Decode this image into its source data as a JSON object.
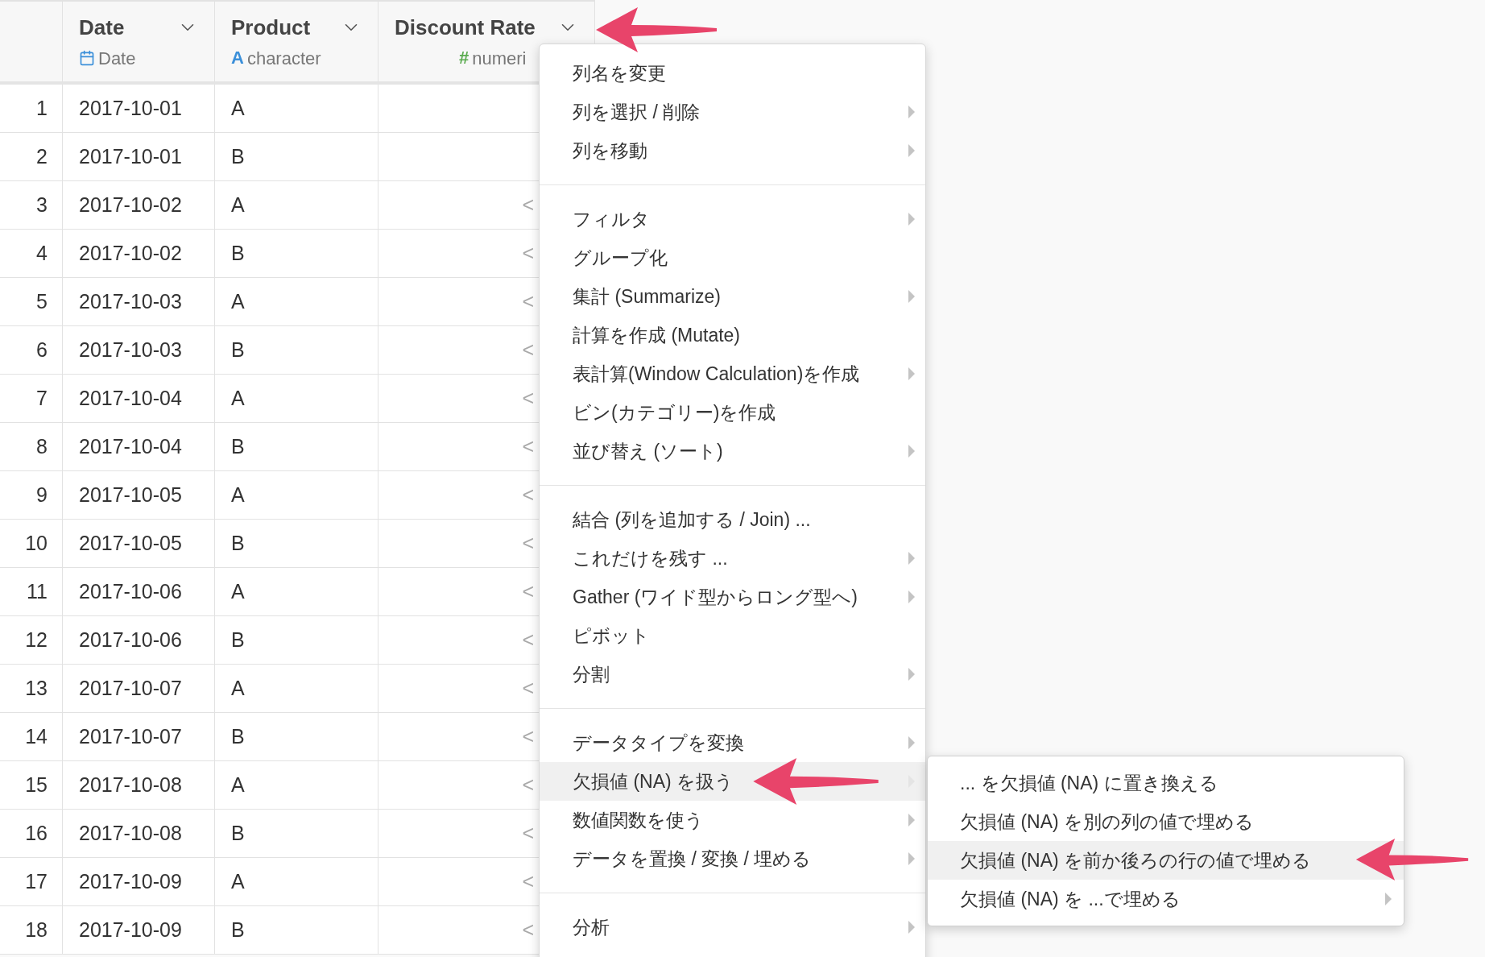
{
  "table": {
    "columns": [
      {
        "name": "Date",
        "type": "Date",
        "kind": "date"
      },
      {
        "name": "Product",
        "type": "character",
        "kind": "character",
        "type_glyph": "A"
      },
      {
        "name": "Discount Rate",
        "type": "numeri",
        "kind": "numeric",
        "type_glyph": "#"
      }
    ],
    "rows": [
      {
        "num": "1",
        "date": "2017-10-01",
        "product": "A"
      },
      {
        "num": "2",
        "date": "2017-10-01",
        "product": "B"
      },
      {
        "num": "3",
        "date": "2017-10-02",
        "product": "A",
        "discount": "<"
      },
      {
        "num": "4",
        "date": "2017-10-02",
        "product": "B",
        "discount": "<"
      },
      {
        "num": "5",
        "date": "2017-10-03",
        "product": "A",
        "discount": "<"
      },
      {
        "num": "6",
        "date": "2017-10-03",
        "product": "B",
        "discount": "<"
      },
      {
        "num": "7",
        "date": "2017-10-04",
        "product": "A",
        "discount": "<"
      },
      {
        "num": "8",
        "date": "2017-10-04",
        "product": "B",
        "discount": "<"
      },
      {
        "num": "9",
        "date": "2017-10-05",
        "product": "A",
        "discount": "<"
      },
      {
        "num": "10",
        "date": "2017-10-05",
        "product": "B",
        "discount": "<"
      },
      {
        "num": "11",
        "date": "2017-10-06",
        "product": "A",
        "discount": "<"
      },
      {
        "num": "12",
        "date": "2017-10-06",
        "product": "B",
        "discount": "<"
      },
      {
        "num": "13",
        "date": "2017-10-07",
        "product": "A",
        "discount": "<"
      },
      {
        "num": "14",
        "date": "2017-10-07",
        "product": "B",
        "discount": "<"
      },
      {
        "num": "15",
        "date": "2017-10-08",
        "product": "A",
        "discount": "<"
      },
      {
        "num": "16",
        "date": "2017-10-08",
        "product": "B",
        "discount": "<"
      },
      {
        "num": "17",
        "date": "2017-10-09",
        "product": "A",
        "discount": "<"
      },
      {
        "num": "18",
        "date": "2017-10-09",
        "product": "B",
        "discount": "<"
      }
    ]
  },
  "context_menu": {
    "sections": [
      [
        {
          "label": "列名を変更",
          "has_submenu": false,
          "selected": false
        },
        {
          "label": "列を選択 / 削除",
          "has_submenu": true,
          "selected": false
        },
        {
          "label": "列を移動",
          "has_submenu": true,
          "selected": false
        }
      ],
      [
        {
          "label": "フィルタ",
          "has_submenu": true,
          "selected": false
        },
        {
          "label": "グループ化",
          "has_submenu": false,
          "selected": false
        },
        {
          "label": "集計 (Summarize)",
          "has_submenu": true,
          "selected": false
        },
        {
          "label": "計算を作成 (Mutate)",
          "has_submenu": false,
          "selected": false
        },
        {
          "label": "表計算(Window Calculation)を作成",
          "has_submenu": true,
          "selected": false
        },
        {
          "label": "ビン(カテゴリー)を作成",
          "has_submenu": false,
          "selected": false
        },
        {
          "label": "並び替え (ソート)",
          "has_submenu": true,
          "selected": false
        }
      ],
      [
        {
          "label": "結合 (列を追加する / Join) ...",
          "has_submenu": false,
          "selected": false
        },
        {
          "label": "これだけを残す ...",
          "has_submenu": true,
          "selected": false
        },
        {
          "label": "Gather (ワイド型からロング型へ)",
          "has_submenu": true,
          "selected": false
        },
        {
          "label": "ピボット",
          "has_submenu": false,
          "selected": false
        },
        {
          "label": "分割",
          "has_submenu": true,
          "selected": false
        }
      ],
      [
        {
          "label": "データタイプを変換",
          "has_submenu": true,
          "selected": false
        },
        {
          "label": "欠損値 (NA) を扱う",
          "has_submenu": true,
          "selected": true
        },
        {
          "label": "数値関数を使う",
          "has_submenu": true,
          "selected": false
        },
        {
          "label": "データを置換 / 変換 / 埋める",
          "has_submenu": true,
          "selected": false
        }
      ],
      [
        {
          "label": "分析",
          "has_submenu": true,
          "selected": false
        }
      ]
    ]
  },
  "submenu": {
    "items": [
      {
        "label": "... を欠損値 (NA) に置き換える",
        "has_submenu": false,
        "selected": false
      },
      {
        "label": "欠損値 (NA) を別の列の値で埋める",
        "has_submenu": false,
        "selected": false
      },
      {
        "label": "欠損値 (NA) を前か後ろの行の値で埋める",
        "has_submenu": false,
        "selected": true
      },
      {
        "label": "欠損値 (NA) を ...で埋める",
        "has_submenu": true,
        "selected": false
      }
    ]
  }
}
